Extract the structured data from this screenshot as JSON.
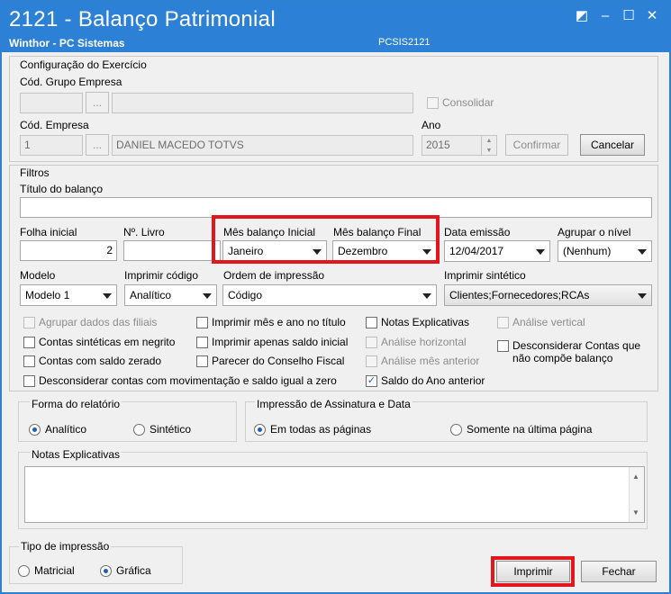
{
  "window": {
    "title": "2121 - Balanço Patrimonial",
    "subtitle": "Winthor - PC Sistemas",
    "code": "PCSIS2121",
    "controls": {
      "restore": "◩",
      "minimize": "‒",
      "maximize": "☐",
      "close": "✕"
    }
  },
  "exercicio": {
    "legend": "Configuração do Exercício",
    "grupo_label": "Cód. Grupo Empresa",
    "grupo_value": "",
    "grupo_btn": "...",
    "grupo_desc": "",
    "consolidar_label": "Consolidar",
    "empresa_label": "Cód. Empresa",
    "empresa_value": "1",
    "empresa_btn": "...",
    "empresa_desc": "DANIEL MACEDO TOTVS",
    "ano_label": "Ano",
    "ano_value": "2015",
    "confirmar_label": "Confirmar",
    "cancelar_label": "Cancelar"
  },
  "filtros": {
    "legend": "Filtros",
    "titulo_label": "Título do balanço",
    "titulo_value": "",
    "folha_label": "Folha inicial",
    "folha_value": "2",
    "livro_label": "Nº. Livro",
    "livro_value": "",
    "mes_inicial_label": "Mês balanço Inicial",
    "mes_inicial_value": "Janeiro",
    "mes_final_label": "Mês balanço Final",
    "mes_final_value": "Dezembro",
    "data_emissao_label": "Data emissão",
    "data_emissao_value": "12/04/2017",
    "agrupar_label": "Agrupar o nível",
    "agrupar_value": "(Nenhum)",
    "modelo_label": "Modelo",
    "modelo_value": "Modelo 1",
    "imprimir_codigo_label": "Imprimir código",
    "imprimir_codigo_value": "Analítico",
    "ordem_label": "Ordem de impressão",
    "ordem_value": "Código",
    "sintetico_label": "Imprimir sintético",
    "sintetico_value": "Clientes;Fornecedores;RCAs",
    "checks": {
      "agrupar_filiais": "Agrupar dados das filiais",
      "contas_negrito": "Contas sintéticas em negrito",
      "contas_zerado": "Contas com saldo zerado",
      "desconsiderar_mov": "Desconsiderar contas com movimentação e saldo igual a zero",
      "imprimir_mes_ano": "Imprimir mês e ano no título",
      "imprimir_saldo": "Imprimir apenas saldo inicial",
      "parecer": "Parecer do Conselho Fiscal",
      "notas": "Notas Explicativas",
      "analise_horizontal": "Análise horizontal",
      "analise_mes": "Análise mês anterior",
      "saldo_ano": "Saldo do Ano anterior",
      "analise_vertical": "Análise vertical",
      "desconsiderar_contas_line1": "Desconsiderar Contas que",
      "desconsiderar_contas_line2": "não compõe balanço"
    },
    "check_mark": "✓"
  },
  "forma": {
    "legend": "Forma do relatório",
    "analitico": "Analítico",
    "sintetico": "Sintético"
  },
  "assinatura": {
    "legend": "Impressão de Assinatura e Data",
    "todas": "Em todas as páginas",
    "ultima": "Somente na última página"
  },
  "notas_panel": {
    "legend": "Notas Explicativas",
    "value": ""
  },
  "tipo": {
    "legend": "Tipo de impressão",
    "matricial": "Matricial",
    "grafica": "Gráfica"
  },
  "footer": {
    "imprimir": "Imprimir",
    "fechar": "Fechar"
  },
  "accents": {
    "titlebar": "#2c80d6",
    "highlight": "#e3161e"
  }
}
